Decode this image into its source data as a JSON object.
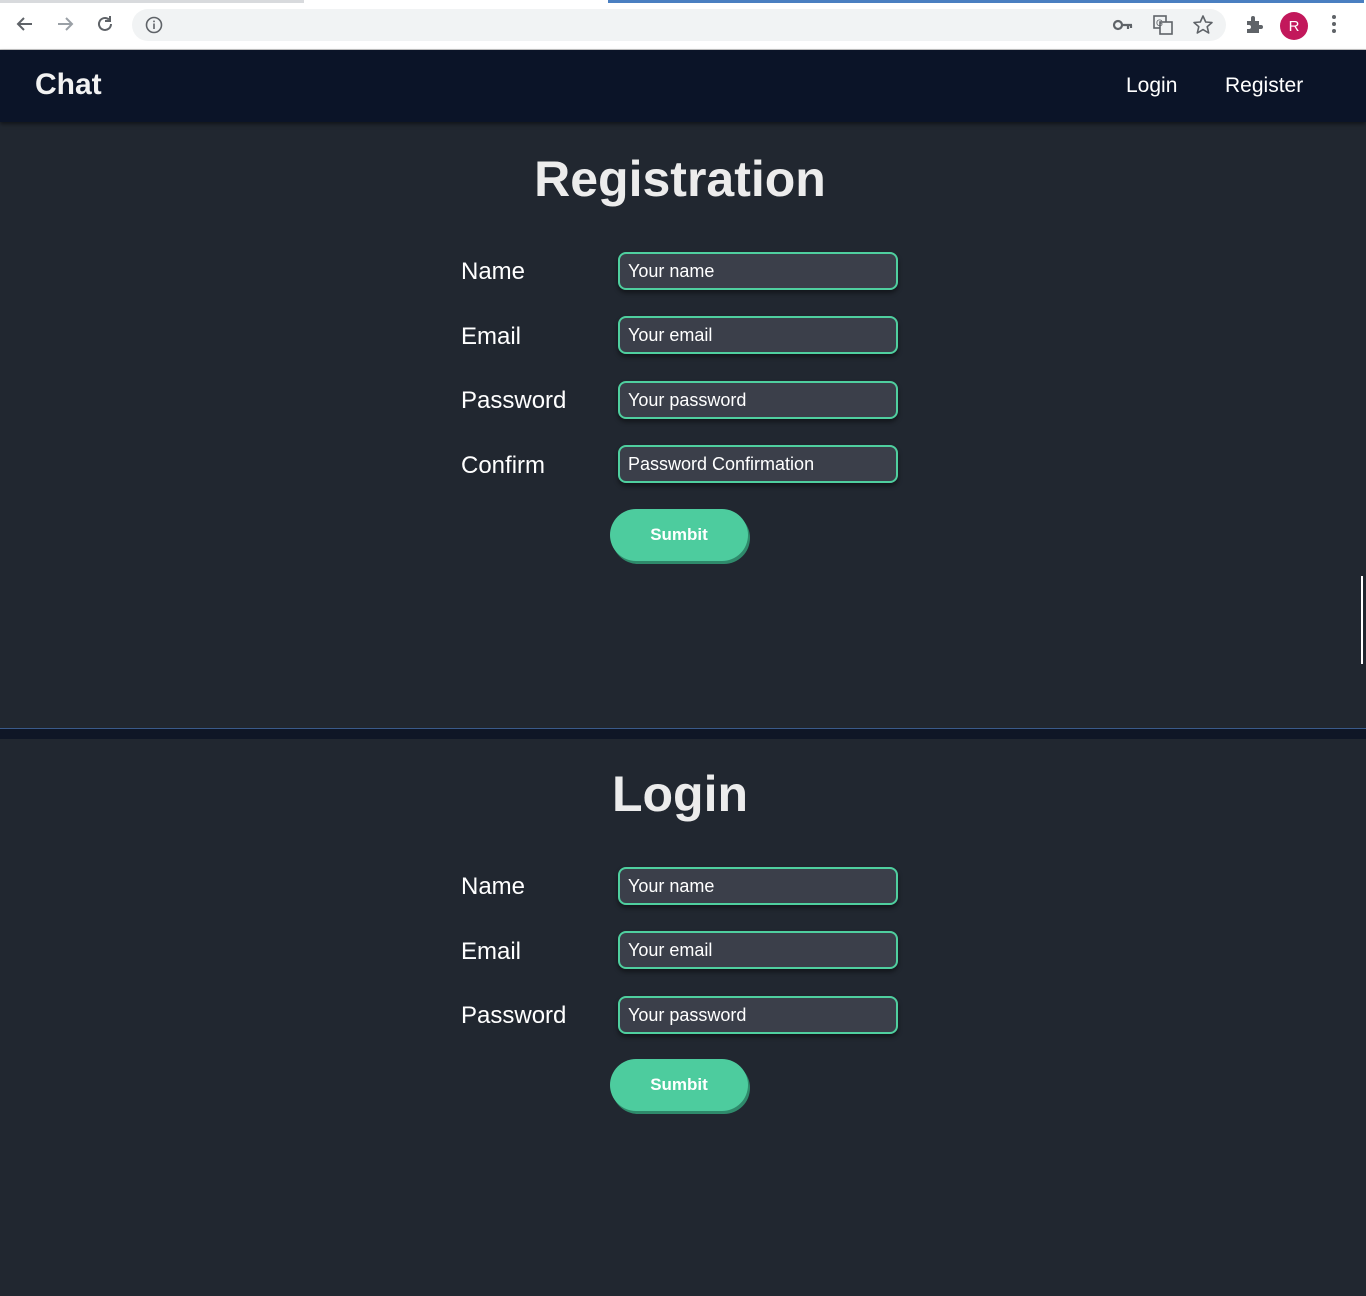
{
  "browser": {
    "avatar_letter": "R",
    "icons": [
      "back-arrow-icon",
      "forward-arrow-icon",
      "reload-icon",
      "site-info-icon",
      "key-icon",
      "translate-icon",
      "star-icon",
      "extensions-icon",
      "menu-dots-icon"
    ]
  },
  "navbar": {
    "brand": "Chat",
    "links": [
      "Login",
      "Register"
    ]
  },
  "registration": {
    "title": "Registration",
    "fields": [
      {
        "label": "Name",
        "placeholder": "Your name"
      },
      {
        "label": "Email",
        "placeholder": "Your email"
      },
      {
        "label": "Password",
        "placeholder": "Your password"
      },
      {
        "label": "Confirm",
        "placeholder": "Password Confirmation"
      }
    ],
    "submit": "Sumbit"
  },
  "login": {
    "title": "Login",
    "fields": [
      {
        "label": "Name",
        "placeholder": "Your name"
      },
      {
        "label": "Email",
        "placeholder": "Your email"
      },
      {
        "label": "Password",
        "placeholder": "Your password"
      }
    ],
    "submit": "Sumbit"
  },
  "colors": {
    "page_bg": "#212730",
    "navbar_bg": "#0b1428",
    "accent": "#4dcc9e",
    "input_bg": "#3b3f4a"
  }
}
